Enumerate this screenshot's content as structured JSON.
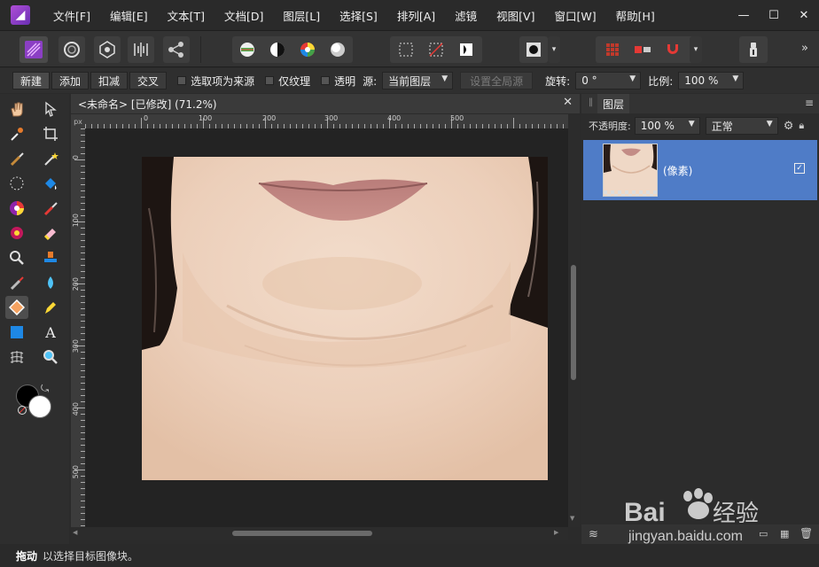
{
  "menu": {
    "items": [
      "文件[F]",
      "编辑[E]",
      "文本[T]",
      "文档[D]",
      "图层[L]",
      "选择[S]",
      "排列[A]",
      "滤镜",
      "视图[V]",
      "窗口[W]",
      "帮助[H]"
    ]
  },
  "window": {
    "minimize": "—",
    "maximize": "☐",
    "close": "✕"
  },
  "context": {
    "new": "新建",
    "add": "添加",
    "subtract": "扣减",
    "intersect": "交叉",
    "sample_source": "选取项为来源",
    "texture_only": "仅纹理",
    "transparent": "透明",
    "source_label": "源:",
    "source_value": "当前图层",
    "global_source": "设置全局源",
    "rotation_label": "旋转:",
    "rotation_value": "0 °",
    "scale_label": "比例:",
    "scale_value": "100 %"
  },
  "document": {
    "tab_title": "<未命名> [已修改] (71.2%)",
    "close": "✕",
    "ruler_unit": "px",
    "ruler_h_ticks": [
      "0",
      "100",
      "200",
      "300",
      "400",
      "500"
    ],
    "ruler_v_ticks": [
      "0",
      "100",
      "200",
      "300",
      "400",
      "500"
    ]
  },
  "layers": {
    "tab": "图层",
    "opacity_label": "不透明度:",
    "opacity_value": "100 %",
    "blend_value": "正常",
    "layer_name": "(像素)"
  },
  "status": {
    "tool": "拖动",
    "hint": "以选择目标图像块。"
  },
  "colors": {
    "accent": "#4f7cc7",
    "logo": "#9b45d0"
  }
}
